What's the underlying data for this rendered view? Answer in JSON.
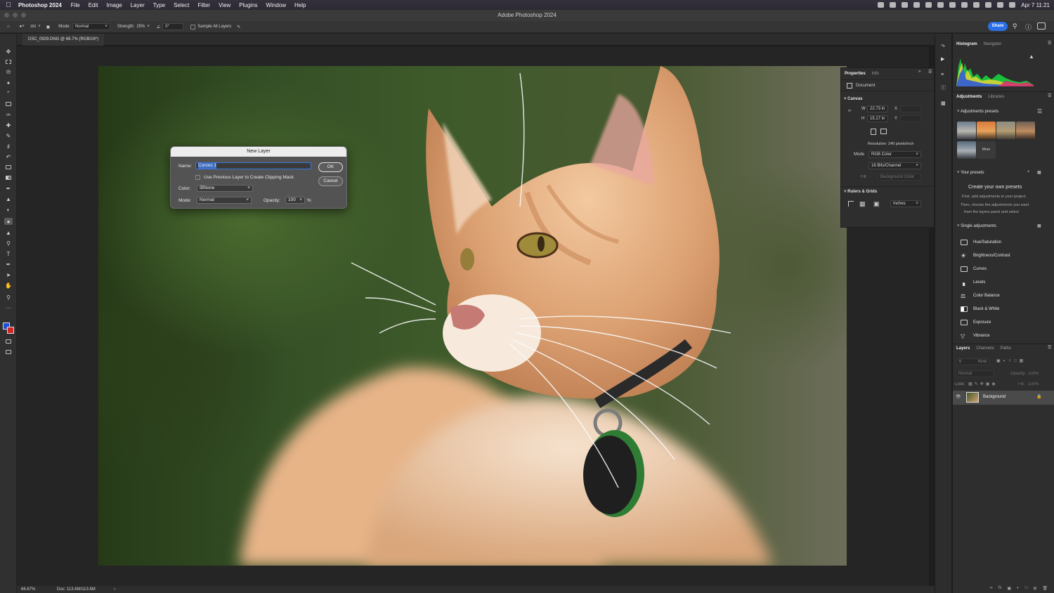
{
  "menubar": {
    "app_name": "Photoshop 2024",
    "items": [
      "File",
      "Edit",
      "Image",
      "Layer",
      "Type",
      "Select",
      "Filter",
      "View",
      "Plugins",
      "Window",
      "Help"
    ],
    "clock": "Apr 7  11:21"
  },
  "window": {
    "title": "Adobe Photoshop 2024"
  },
  "options_bar": {
    "brush_size": "160",
    "mode_label": "Mode:",
    "mode_value": "Normal",
    "strength_label": "Strength:",
    "strength_value": "25%",
    "angle_value": "0°",
    "sample_all_layers": "Sample All Layers",
    "share_label": "Share"
  },
  "document": {
    "tab_title": "DSC_0929.DNG @ 66.7% (RGB/16*)"
  },
  "status_bar": {
    "zoom": "66.67%",
    "doc_size": "Doc: 113.6M/113.6M"
  },
  "dialog": {
    "title": "New Layer",
    "name_label": "Name:",
    "name_value": "Curves 1",
    "clipping_mask_label": "Use Previous Layer to Create Clipping Mask",
    "color_label": "Color:",
    "color_value": "None",
    "mode_label": "Mode:",
    "mode_value": "Normal",
    "opacity_label": "Opacity:",
    "opacity_value": "100",
    "opacity_unit": "%",
    "ok_label": "OK",
    "cancel_label": "Cancel"
  },
  "properties_panel": {
    "tabs": [
      "Properties",
      "Info"
    ],
    "document_label": "Document",
    "canvas_label": "Canvas",
    "w_label": "W",
    "w_value": "22.73 in",
    "h_label": "H",
    "h_value": "15.17 in",
    "x_label": "X",
    "y_label": "Y",
    "resolution": "Resolution: 240 pixels/inch",
    "mode_label": "Mode",
    "mode_value": "RGB Color",
    "bits_value": "16 Bits/Channel",
    "fill_label": "Fill",
    "fill_value": "Background Color",
    "rulers_label": "Rulers & Grids",
    "units_value": "Inches"
  },
  "histogram_panel": {
    "tabs": [
      "Histogram",
      "Navigator"
    ]
  },
  "adjustments_panel": {
    "tabs": [
      "Adjustments",
      "Libraries"
    ],
    "presets_label": "Adjustments presets",
    "more_label": "More",
    "your_presets_label": "Your presets",
    "create_title": "Create your own presets",
    "create_body_1": "First, add adjustments to your project.",
    "create_body_2": "Then, choose the adjustments you want",
    "create_body_3": "from the layers panel and select",
    "single_adjustments_label": "Single adjustments",
    "items": [
      "Hue/Saturation",
      "Brightness/Contrast",
      "Curves",
      "Levels",
      "Color Balance",
      "Black & White",
      "Exposure",
      "Vibrance"
    ]
  },
  "layers_panel": {
    "tabs": [
      "Layers",
      "Channels",
      "Paths"
    ],
    "kind_placeholder": "Kind",
    "blend_mode": "Normal",
    "opacity_label": "Opacity:",
    "opacity_value": "100%",
    "lock_label": "Lock:",
    "fill_label": "Fill:",
    "fill_value": "100%",
    "layer_name": "Background"
  },
  "colors": {
    "accent": "#2b6fe6",
    "foreground": "#1f4fd1",
    "background": "#d22626"
  }
}
